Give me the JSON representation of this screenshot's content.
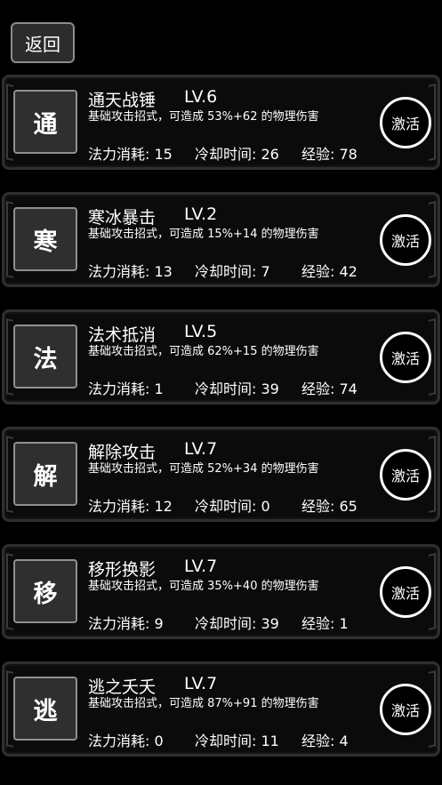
{
  "header": {
    "back_label": "返回"
  },
  "skills": [
    {
      "icon_char": "通",
      "name": "通天战锤",
      "level": "LV.6",
      "desc": "基础攻击招式，可造成 53%+62 的物理伤害",
      "mana": "法力消耗: 15",
      "cooldown": "冷却时间: 26",
      "exp": "经验: 78",
      "button": "激活"
    },
    {
      "icon_char": "寒",
      "name": "寒冰暴击",
      "level": "LV.2",
      "desc": "基础攻击招式，可造成 15%+14 的物理伤害",
      "mana": "法力消耗: 13",
      "cooldown": "冷却时间: 7",
      "exp": "经验: 42",
      "button": "激活"
    },
    {
      "icon_char": "法",
      "name": "法术抵消",
      "level": "LV.5",
      "desc": "基础攻击招式，可造成 62%+15 的物理伤害",
      "mana": "法力消耗: 1",
      "cooldown": "冷却时间: 39",
      "exp": "经验: 74",
      "button": "激活"
    },
    {
      "icon_char": "解",
      "name": "解除攻击",
      "level": "LV.7",
      "desc": "基础攻击招式，可造成 52%+34 的物理伤害",
      "mana": "法力消耗: 12",
      "cooldown": "冷却时间: 0",
      "exp": "经验: 65",
      "button": "激活"
    },
    {
      "icon_char": "移",
      "name": "移形换影",
      "level": "LV.7",
      "desc": "基础攻击招式，可造成 35%+40 的物理伤害",
      "mana": "法力消耗: 9",
      "cooldown": "冷却时间: 39",
      "exp": "经验: 1",
      "button": "激活"
    },
    {
      "icon_char": "逃",
      "name": "逃之夭夭",
      "level": "LV.7",
      "desc": "基础攻击招式，可造成 87%+91 的物理伤害",
      "mana": "法力消耗: 0",
      "cooldown": "冷却时间: 11",
      "exp": "经验: 4",
      "button": "激活"
    }
  ]
}
